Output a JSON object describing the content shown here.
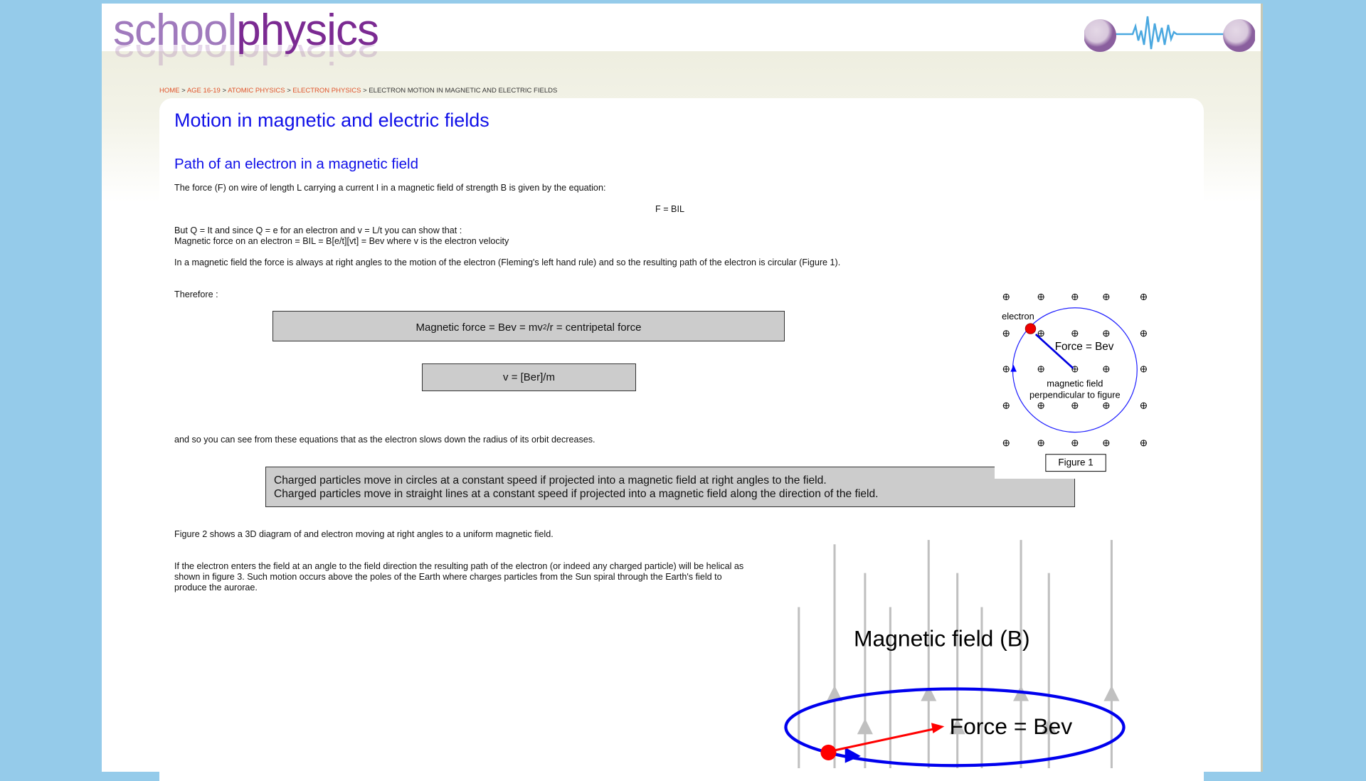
{
  "header": {
    "logo_part1": "school",
    "logo_part2": "physics"
  },
  "breadcrumb": {
    "items": [
      "HOME",
      "AGE 16-19",
      "ATOMIC PHYSICS",
      "ELECTRON PHYSICS"
    ],
    "current": "ELECTRON MOTION IN MAGNETIC AND ELECTRIC FIELDS",
    "separator": ">"
  },
  "main": {
    "title": "Motion in magnetic and electric fields",
    "subtitle": "Path of an electron in a magnetic field",
    "p1": "The force (F) on wire of length L carrying a current I in a magnetic field of strength B is given by the equation:",
    "eq1": "F = BIL",
    "p2a": "But Q = It and since Q = e for an electron and v = L/t you can show that :",
    "p2b": "Magnetic force on an electron = BIL = B[e/t][vt] = Bev where v is the electron velocity",
    "p3": "In a magnetic field the force is always at right angles to the motion of the electron (Fleming's left hand rule) and so the resulting path of the electron is circular (Figure 1).",
    "therefore": "Therefore :",
    "box1_pre": "Magnetic force = Bev = mv",
    "box1_sup": "2",
    "box1_post": "/r = centripetal force",
    "box2": "v = [Ber]/m",
    "p4": "and so you can see from these equations that as the electron slows down the radius of its orbit decreases.",
    "box3_line1": "Charged particles move in circles at a constant speed if projected into a magnetic field at right angles to the field.",
    "box3_line2": "Charged particles move in straight lines at a constant speed if projected into a magnetic field along the direction of the field.",
    "p5": "Figure 2 shows a 3D diagram of and electron moving at right angles to a uniform magnetic field.",
    "p6": "If the electron enters the field at an angle to the field direction the resulting path of the electron (or indeed any charged particle) will be helical as shown in figure 3. Such motion occurs above the poles of the Earth where charges particles from the Sun spiral through the Earth's field to produce the aurorae."
  },
  "figure1": {
    "electron_label": "electron",
    "force_label": "Force = Bev",
    "field_label1": "magnetic field",
    "field_label2": "perpendicular to figure",
    "caption": "Figure 1"
  },
  "figure3": {
    "field_label": "Magnetic field (B)",
    "force_label": "Force = Bev"
  },
  "colors": {
    "link": "#e0532a",
    "heading": "#1010e8",
    "background": "#95cbea"
  }
}
